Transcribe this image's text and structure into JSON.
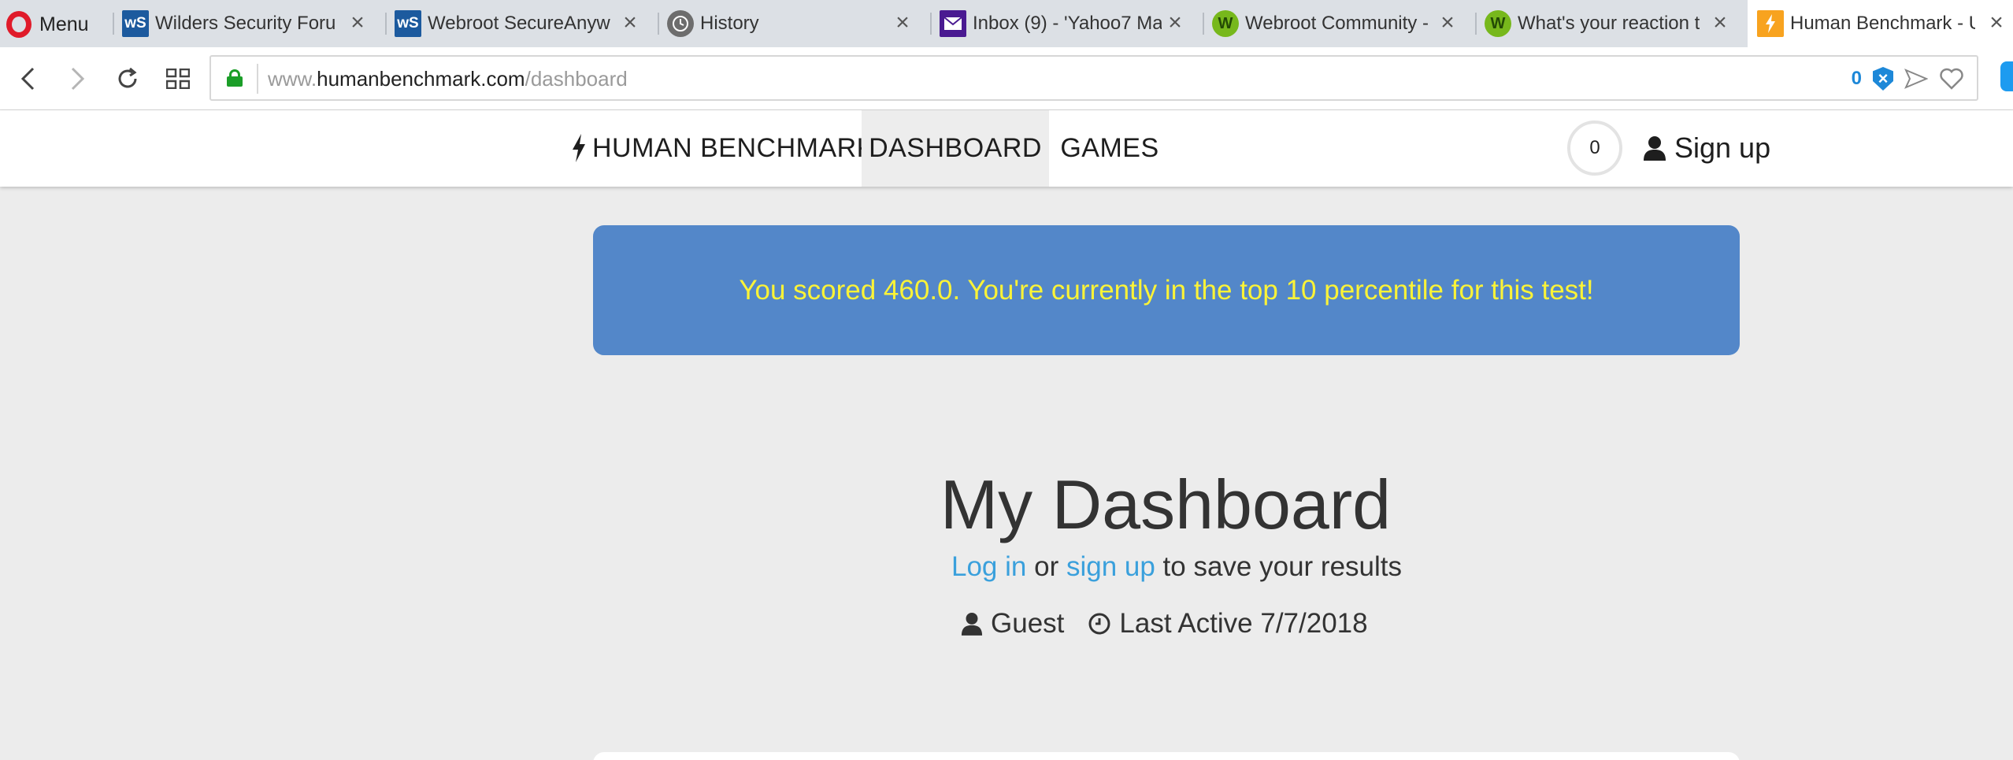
{
  "browser": {
    "menu_label": "Menu",
    "tabs": [
      {
        "title": "Wilders Security Foru",
        "favicon": "wilders-ws-icon",
        "active": false
      },
      {
        "title": "Webroot SecureAnyw",
        "favicon": "wilders-ws-icon",
        "active": false
      },
      {
        "title": "History",
        "favicon": "history-clock-icon",
        "active": false
      },
      {
        "title": "Inbox (9) - 'Yahoo7 Ma",
        "favicon": "yahoo-mail-icon",
        "active": false
      },
      {
        "title": "Webroot Community -",
        "favicon": "webroot-icon",
        "active": false
      },
      {
        "title": "What's your reaction t",
        "favicon": "webroot-icon",
        "active": false
      },
      {
        "title": "Human Benchmark - U",
        "favicon": "human-benchmark-icon",
        "active": true
      }
    ],
    "address": {
      "prefix": "www.",
      "domain": "humanbenchmark.com",
      "path": "/dashboard"
    },
    "adblock_count": "0"
  },
  "site": {
    "brand": "HUMAN BENCHMARK",
    "nav": {
      "dashboard": "DASHBOARD",
      "games": "GAMES"
    },
    "score_badge": "0",
    "signup": "Sign up"
  },
  "main": {
    "banner": "You scored 460.0. You're currently in the top 10 percentile for this test!",
    "title": "My Dashboard",
    "login_link": "Log in",
    "or_text": " or ",
    "signup_link": "sign up",
    "save_text": " to save your results",
    "user": "Guest",
    "last_active": "Last Active 7/7/2018"
  },
  "colors": {
    "banner_bg": "#5387c9",
    "banner_text": "#fbf337",
    "link": "#3aa0dc",
    "page_bg": "#ececec"
  }
}
